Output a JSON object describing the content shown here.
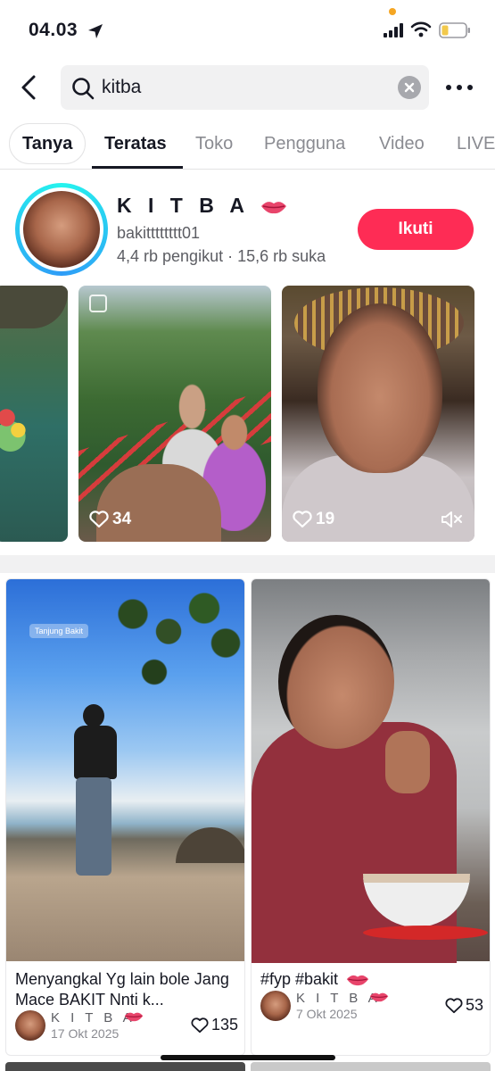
{
  "status_bar": {
    "time": "04.03"
  },
  "search": {
    "query": "kitba"
  },
  "tabs": [
    {
      "label": "Tanya"
    },
    {
      "label": "Teratas"
    },
    {
      "label": "Toko"
    },
    {
      "label": "Pengguna"
    },
    {
      "label": "Video"
    },
    {
      "label": "LIVE"
    }
  ],
  "active_tab": "Teratas",
  "account": {
    "name": "K I T B A",
    "handle": "bakitttttttt01",
    "stats": "4,4 rb pengikut · 15,6 rb suka",
    "follow_label": "Ikuti"
  },
  "strip_videos": [
    {
      "likes": ""
    },
    {
      "likes": "34"
    },
    {
      "likes": "19"
    }
  ],
  "cards": [
    {
      "location_tag": "Tanjung Bakit",
      "caption": "Menyangkal Yg lain bole Jang Mace BAKIT Nnti k...",
      "author": "K I T B A",
      "date": "17 Okt 2025",
      "likes": "135"
    },
    {
      "caption": "#fyp #bakit",
      "author": "K I T B A",
      "date": "7 Okt 2025",
      "likes": "53"
    }
  ],
  "colors": {
    "accent": "#fe2c55",
    "ring": "#25f4ee",
    "text": "#161823"
  },
  "icons": [
    "location-arrow-icon",
    "signal-icon",
    "wifi-icon",
    "battery-icon",
    "back-icon",
    "search-icon",
    "clear-icon",
    "more-icon",
    "lips-icon",
    "heart-icon",
    "mute-icon"
  ]
}
